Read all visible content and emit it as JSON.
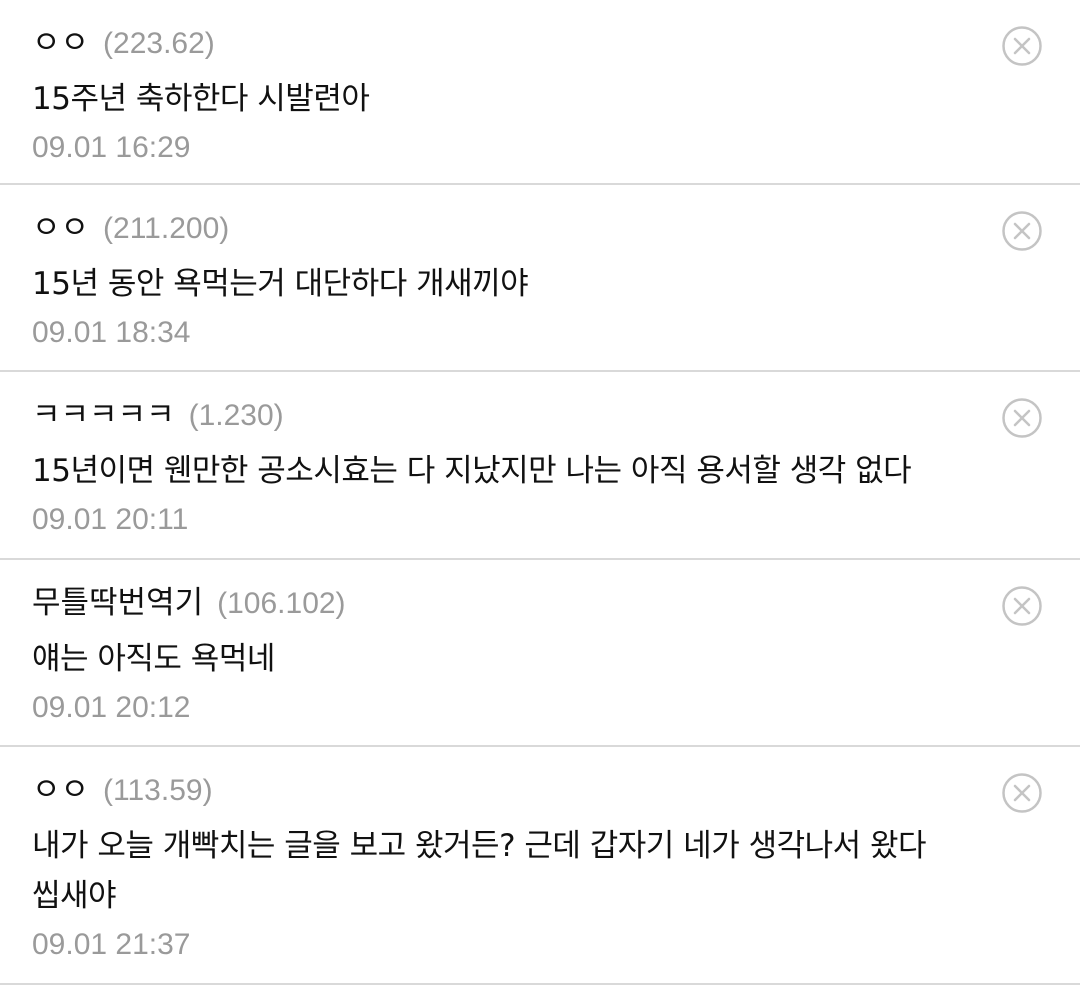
{
  "comments": [
    {
      "nickname": "ㅇㅇ",
      "ip": "(223.62)",
      "text": "15주년 축하한다 시발련아",
      "timestamp": "09.01 16:29"
    },
    {
      "nickname": "ㅇㅇ",
      "ip": "(211.200)",
      "text": "15년 동안 욕먹는거 대단하다 개새끼야",
      "timestamp": "09.01 18:34"
    },
    {
      "nickname": "ㅋㅋㅋㅋㅋ",
      "ip": "(1.230)",
      "text": "15년이면 웬만한 공소시효는 다 지났지만 나는 아직 용서할 생각 없다",
      "timestamp": "09.01 20:11"
    },
    {
      "nickname": "무틀딱번역기",
      "ip": "(106.102)",
      "text": "얘는 아직도 욕먹네",
      "timestamp": "09.01 20:12"
    },
    {
      "nickname": "ㅇㅇ",
      "ip": "(113.59)",
      "text": "내가 오늘 개빡치는 글을 보고 왔거든? 근데 갑자기 네가 생각나서 왔다 씹새야",
      "timestamp": "09.01 21:37"
    }
  ],
  "icons": {
    "delete": "close-circle-icon"
  },
  "colors": {
    "text": "#111111",
    "meta": "#9a9a9a",
    "divider": "#d9d9d9",
    "icon": "#c4c4c4"
  }
}
